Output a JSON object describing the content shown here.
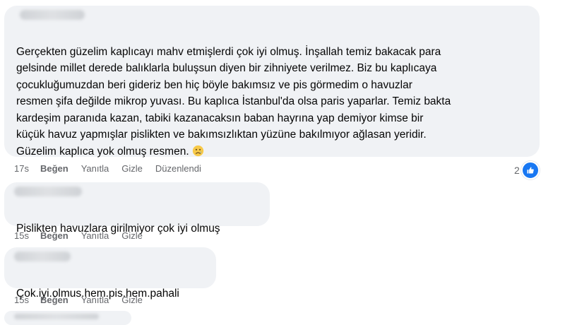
{
  "comments": [
    {
      "text": "Gerçekten güzelim kaplıcayı mahv etmişlerdi çok iyi olmuş. İnşallah temiz bakacak para\ngelsinde millet derede balıklarla buluşsun diyen bir zihniyete verilmez. Biz bu kaplıcaya\nçocukluğumuzdan beri gideriz ben hiç böyle bakımsız ve pis görmedim o havuzlar\nresmen şifa değilde mikrop yuvası. Bu kaplıca İstanbul'da olsa paris yaparlar. Temiz bakta\nkardeşim paranıda kazan, tabiki kazanacaksın baban hayrına yap demiyor kimse bir\nküçük havuz yapmışlar pislikten ve bakımsızlıktan yüzüne bakılmıyor ağlasan yeridir.\nGüzelim kaplıca yok olmuş resmen.",
      "emoji": "sad-face-emoji",
      "time": "17s",
      "like_label": "Beğen",
      "reply_label": "Yanıtla",
      "hide_label": "Gizle",
      "edited_label": "Düzenlendi",
      "reaction_count": "2"
    },
    {
      "text": "Pislikten havuzlara girilmiyor çok iyi olmuş",
      "time": "15s",
      "like_label": "Beğen",
      "reply_label": "Yanıtla",
      "hide_label": "Gizle"
    },
    {
      "text": "Çok.iyi.olmus.hem.pis.hem.pahali",
      "time": "15s",
      "like_label": "Beğen",
      "reply_label": "Yanıtla",
      "hide_label": "Gizle"
    }
  ],
  "colors": {
    "bubble": "#f0f2f5",
    "text": "#050505",
    "meta": "#65676b",
    "like_blue": "#1877f2"
  }
}
